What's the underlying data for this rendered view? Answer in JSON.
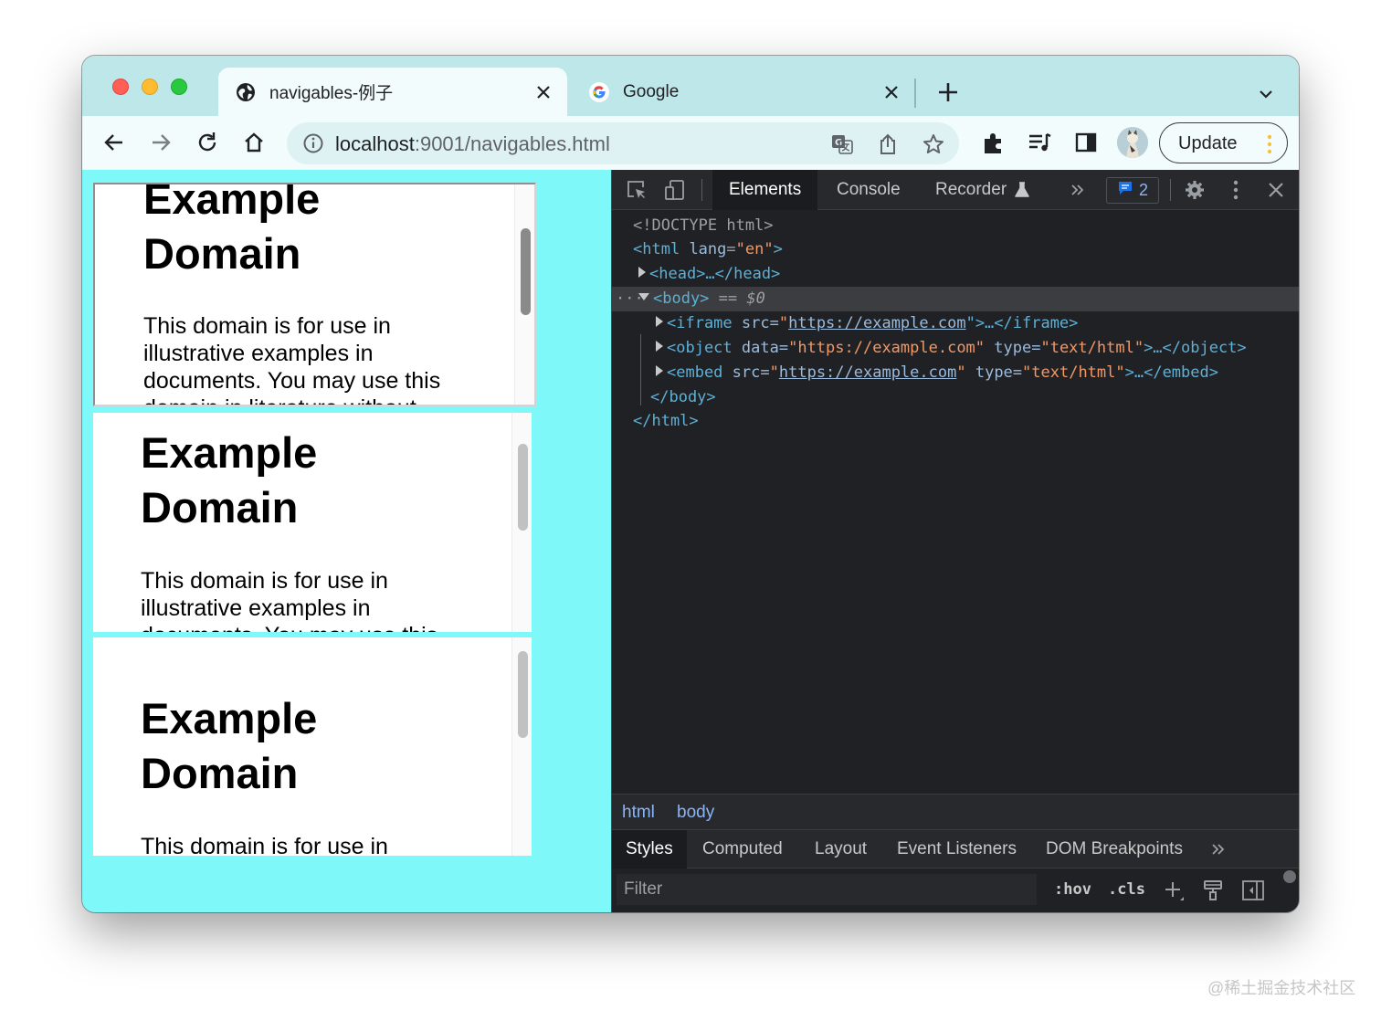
{
  "tabs": [
    {
      "title": "navigables-例子",
      "icon": "globe-icon",
      "active": true
    },
    {
      "title": "Google",
      "icon": "google-icon",
      "active": false
    }
  ],
  "omnibox": {
    "host": "localhost",
    "rest": ":9001/navigables.html"
  },
  "toolbar": {
    "update_label": "Update"
  },
  "frames": [
    {
      "heading": "Example Domain",
      "text": "This domain is for use in illustrative examples in documents. You may use this domain in literature without"
    },
    {
      "heading": "Example Domain",
      "text": "This domain is for use in illustrative examples in documents. You may use this"
    },
    {
      "heading": "Example Domain",
      "text": "This domain is for use in"
    }
  ],
  "devtools": {
    "tabs": [
      "Elements",
      "Console",
      "Recorder"
    ],
    "issues_count": "2",
    "dom": {
      "doctype": "<!DOCTYPE html>",
      "html_open_tag": "<html",
      "html_lang_attr": "lang",
      "html_lang_val": "\"en\"",
      "head": "<head>…</head>",
      "body_open": "<body>",
      "body_eq": "== $0",
      "iframe_tag": "<iframe",
      "iframe_attr": "src=",
      "iframe_url": "https://example.com",
      "iframe_close": "\">…</iframe>",
      "object_tag": "<object",
      "object_attr": "data=",
      "object_url": "\"https://example.com\"",
      "object_type_attr": "type=",
      "object_type_val": "\"text/html\"",
      "object_close": ">…</object>",
      "embed_tag": "<embed",
      "embed_attr": "src=",
      "embed_url": "https://example.com",
      "embed_type_attr": "type=",
      "embed_type_val": "\"text/html\"",
      "embed_close": ">…</embed>",
      "body_close": "</body>",
      "html_close": "</html>"
    },
    "breadcrumbs": [
      "html",
      "body"
    ],
    "subtabs": [
      "Styles",
      "Computed",
      "Layout",
      "Event Listeners",
      "DOM Breakpoints"
    ],
    "filter_placeholder": "Filter",
    "hov": ":hov",
    "cls": ".cls"
  },
  "watermark": "@稀土掘金技术社区",
  "colors": {
    "page_bg": "#7ef8f8",
    "devtools_bg": "#202124",
    "tag": "#5db0d7",
    "attr_value": "#f29766"
  }
}
